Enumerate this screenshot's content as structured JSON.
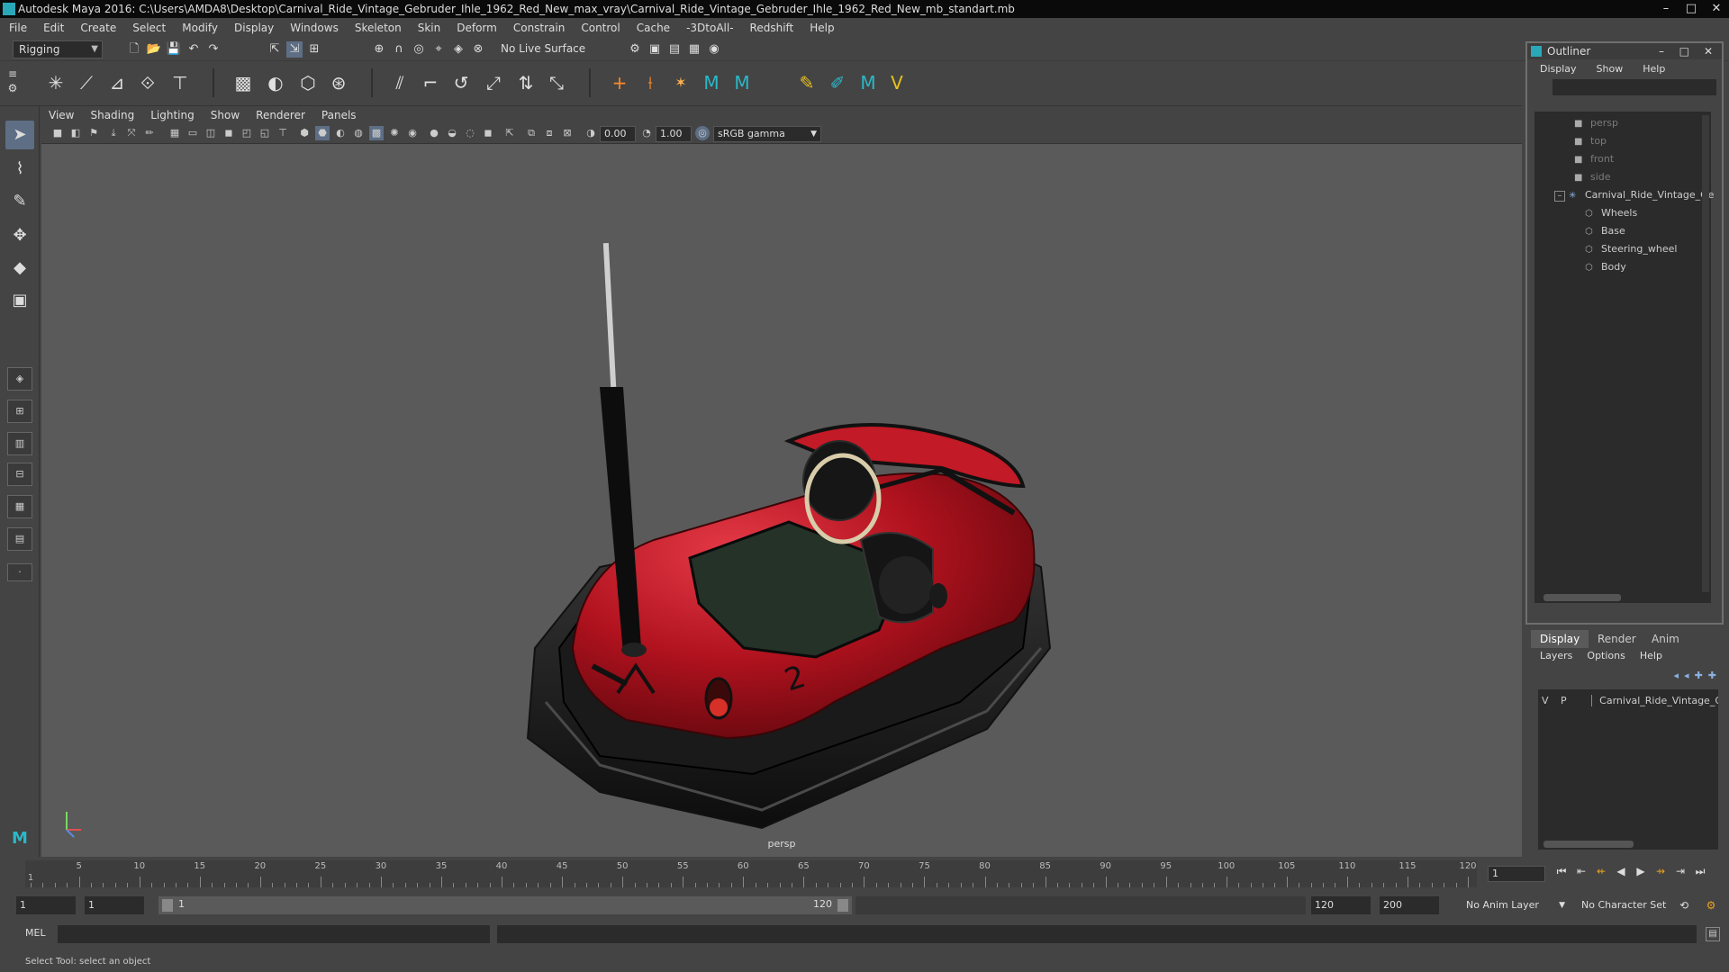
{
  "window": {
    "title": "Autodesk Maya 2016: C:\\Users\\AMDA8\\Desktop\\Carnival_Ride_Vintage_Gebruder_Ihle_1962_Red_New_max_vray\\Carnival_Ride_Vintage_Gebruder_Ihle_1962_Red_New_mb_standart.mb",
    "minimize": "–",
    "maximize": "□",
    "close": "✕"
  },
  "menubar": [
    "File",
    "Edit",
    "Create",
    "Select",
    "Modify",
    "Display",
    "Windows",
    "Skeleton",
    "Skin",
    "Deform",
    "Constrain",
    "Control",
    "Cache",
    "-3DtoAll-",
    "Redshift",
    "Help"
  ],
  "toolbar": {
    "mode": "Rigging",
    "live_surface": "No Live Surface"
  },
  "viewport": {
    "menu": [
      "View",
      "Shading",
      "Lighting",
      "Show",
      "Renderer",
      "Panels"
    ],
    "exposure": "0.00",
    "gamma": "1.00",
    "color_space": "sRGB gamma",
    "camera_label": "persp",
    "model_number": "2"
  },
  "outliner": {
    "title": "Outliner",
    "menu": [
      "Display",
      "Show",
      "Help"
    ],
    "cameras": [
      "persp",
      "top",
      "front",
      "side"
    ],
    "root": "Carnival_Ride_Vintage_Ge",
    "children": [
      "Wheels",
      "Base",
      "Steering_wheel",
      "Body"
    ]
  },
  "layers": {
    "tabs": [
      "Display",
      "Render",
      "Anim"
    ],
    "menu": [
      "Layers",
      "Options",
      "Help"
    ],
    "row": {
      "v": "V",
      "p": "P",
      "name": "Carnival_Ride_Vintage_Ge"
    }
  },
  "timeline": {
    "ticks": [
      1,
      5,
      10,
      15,
      20,
      25,
      30,
      35,
      40,
      45,
      50,
      55,
      60,
      65,
      70,
      75,
      80,
      85,
      90,
      95,
      100,
      105,
      110,
      115,
      120
    ],
    "current_frame": "1"
  },
  "range": {
    "start": "1",
    "current": "1",
    "slider_start": "1",
    "slider_end": "120",
    "end": "120",
    "max": "200",
    "anim_layer": "No Anim Layer",
    "character_set": "No Character Set"
  },
  "mel": {
    "label": "MEL"
  },
  "status": {
    "text": "Select Tool: select an object"
  },
  "colors": {
    "accent": "#5d6e85",
    "car_red": "#b0121e"
  }
}
